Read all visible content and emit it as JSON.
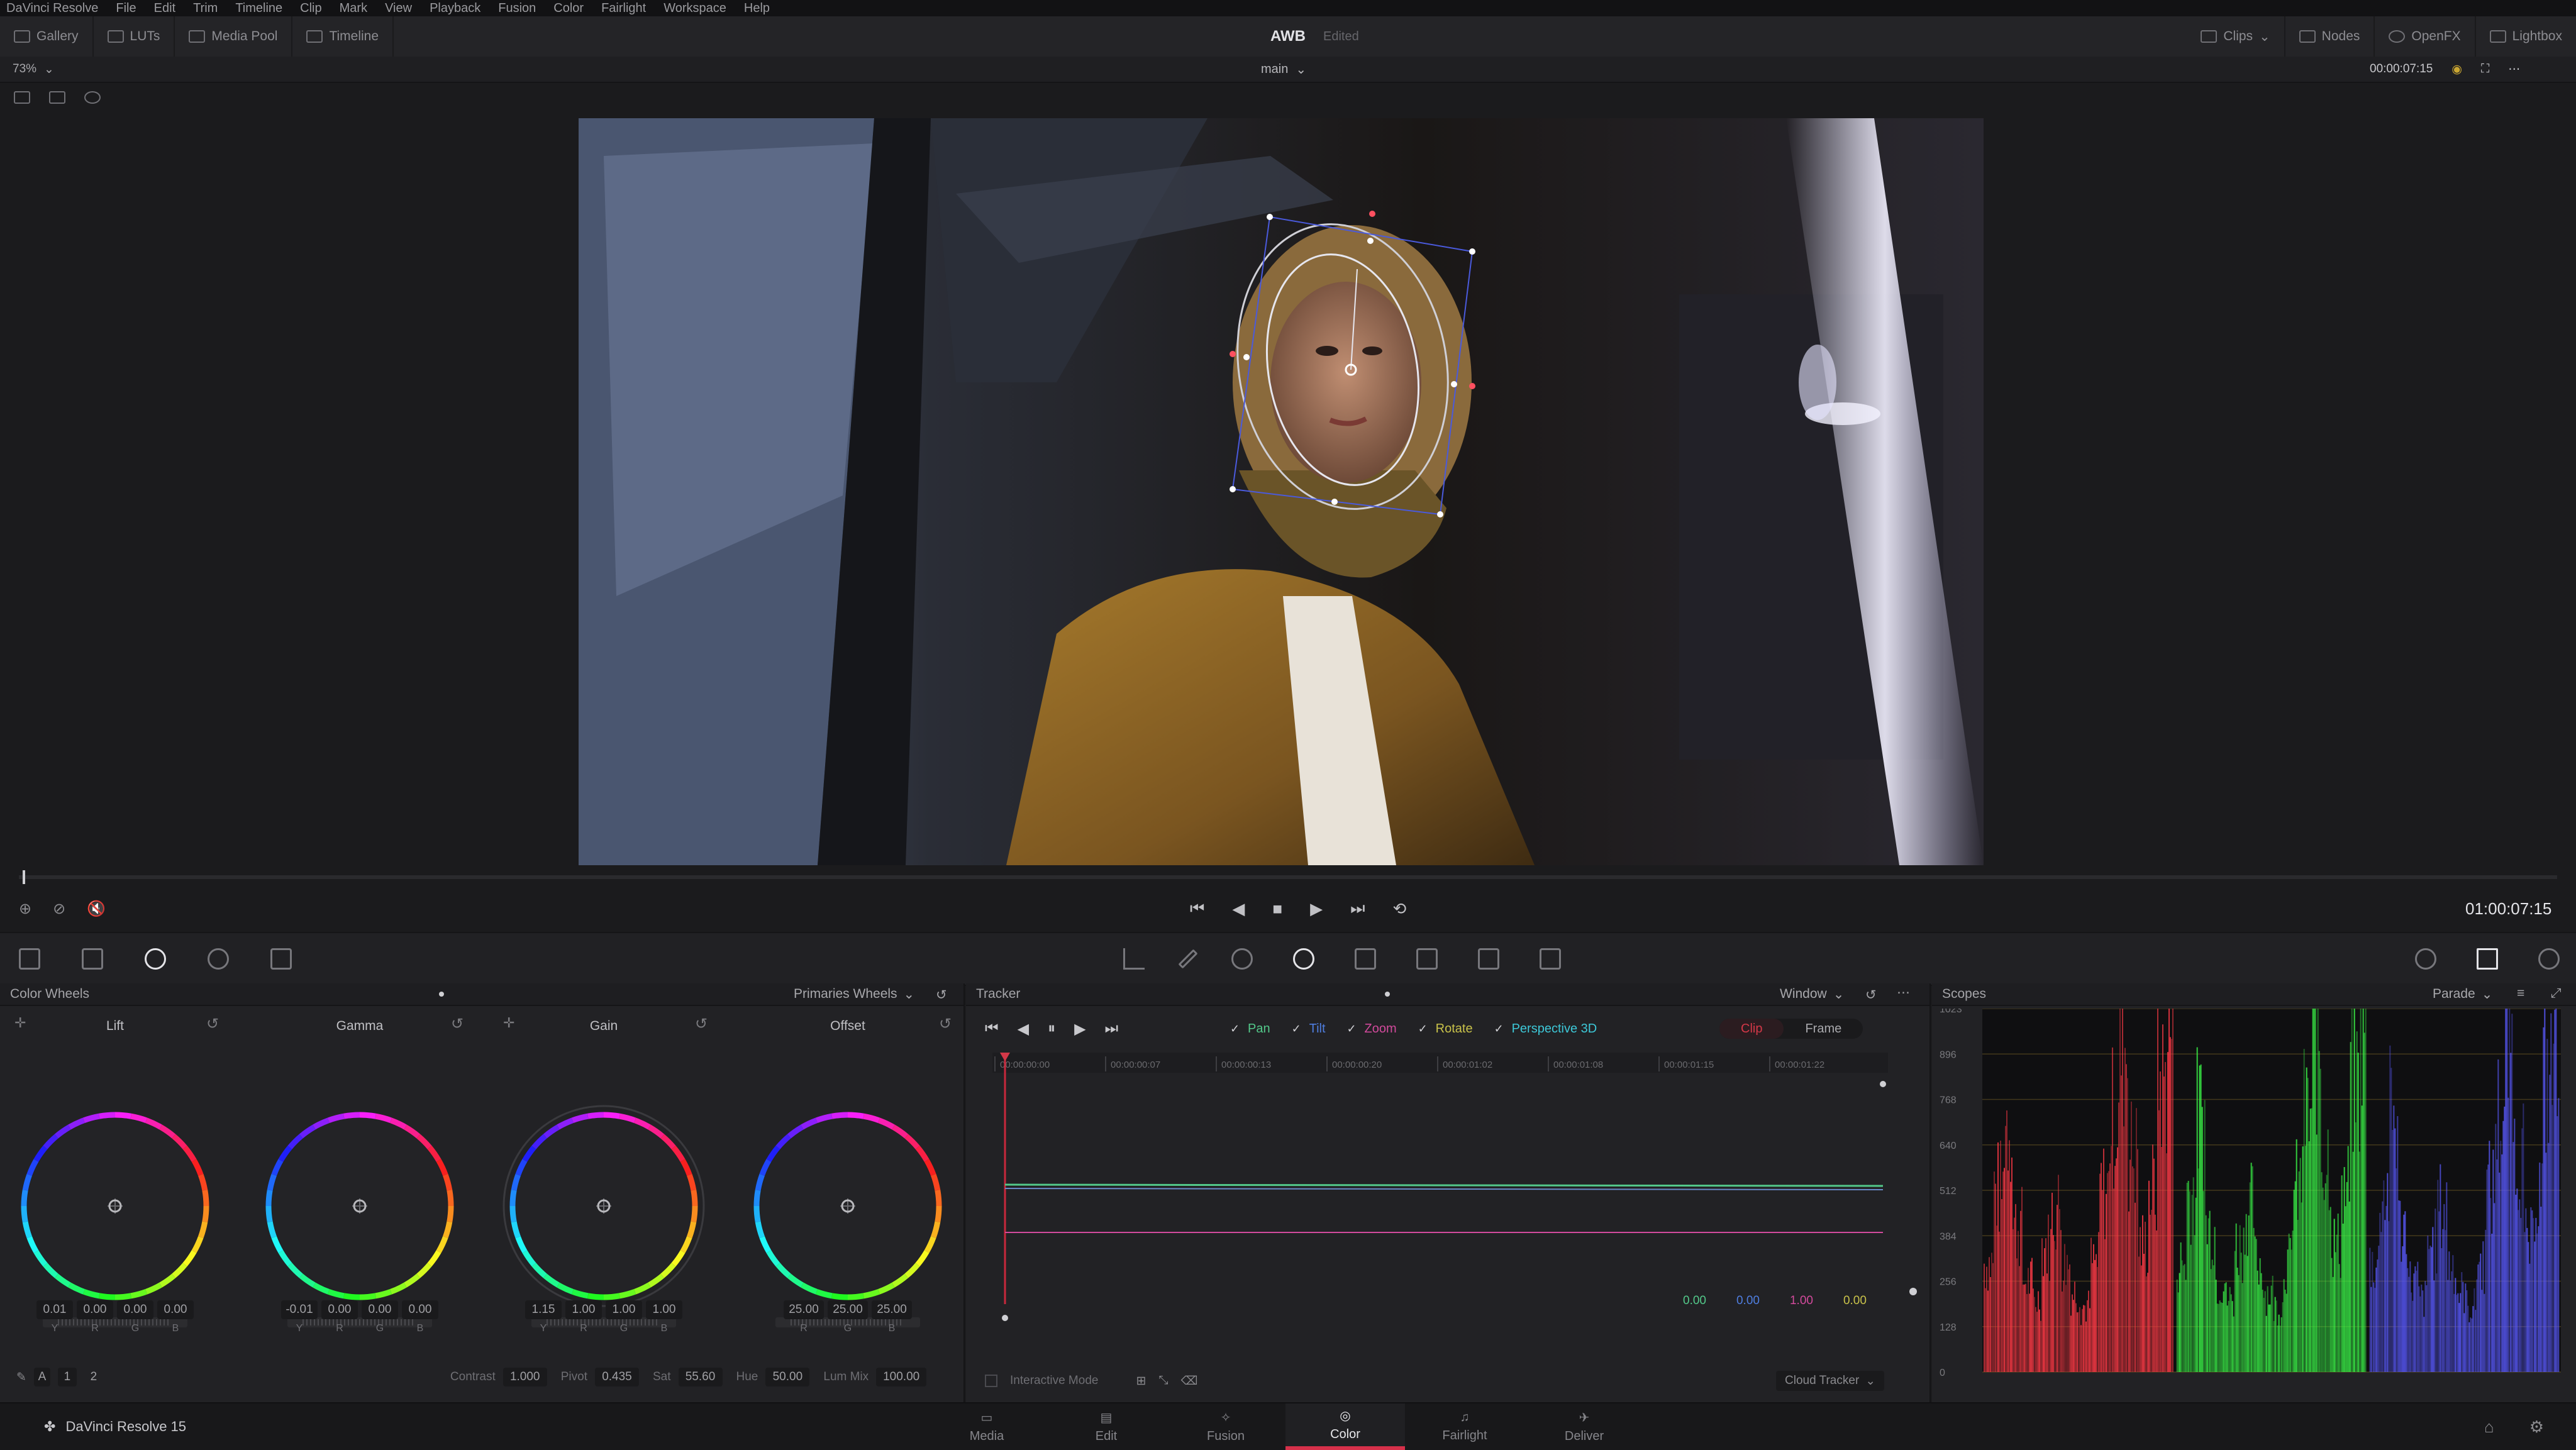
{
  "menu": [
    "DaVinci Resolve",
    "File",
    "Edit",
    "Trim",
    "Timeline",
    "Clip",
    "Mark",
    "View",
    "Playback",
    "Fusion",
    "Color",
    "Fairlight",
    "Workspace",
    "Help"
  ],
  "toolbar": {
    "left": [
      "Gallery",
      "LUTs",
      "Media Pool",
      "Timeline"
    ],
    "project_title": "AWB",
    "project_status": "Edited",
    "right": [
      "Clips",
      "Nodes",
      "OpenFX",
      "Lightbox"
    ]
  },
  "viewer": {
    "zoom": "73%",
    "timeline_name": "main",
    "source_timecode": "00:00:07:15",
    "record_timecode": "01:00:07:15"
  },
  "color_wheels": {
    "title": "Color Wheels",
    "mode": "Primaries Wheels",
    "wheels": [
      {
        "name": "Lift",
        "values": [
          "0.01",
          "0.00",
          "0.00",
          "0.00"
        ]
      },
      {
        "name": "Gamma",
        "values": [
          "-0.01",
          "0.00",
          "0.00",
          "0.00"
        ]
      },
      {
        "name": "Gain",
        "values": [
          "1.15",
          "1.00",
          "1.00",
          "1.00"
        ]
      },
      {
        "name": "Offset",
        "values": [
          "25.00",
          "25.00",
          "25.00"
        ]
      }
    ],
    "channel_labels": [
      "Y",
      "R",
      "G",
      "B"
    ],
    "offset_labels": [
      "R",
      "G",
      "B"
    ],
    "pages": [
      "1",
      "2"
    ],
    "adjust": {
      "contrast_label": "Contrast",
      "contrast": "1.000",
      "pivot_label": "Pivot",
      "pivot": "0.435",
      "sat_label": "Sat",
      "sat": "55.60",
      "hue_label": "Hue",
      "hue": "50.00",
      "lummix_label": "Lum Mix",
      "lummix": "100.00"
    }
  },
  "tracker": {
    "title": "Tracker",
    "mode": "Window",
    "options": [
      {
        "label": "Pan",
        "color": "#53c98a"
      },
      {
        "label": "Tilt",
        "color": "#4f7ee0"
      },
      {
        "label": "Zoom",
        "color": "#d24a9c"
      },
      {
        "label": "Rotate",
        "color": "#c9c24a"
      },
      {
        "label": "Perspective 3D",
        "color": "#3dc8d8"
      }
    ],
    "clip_label": "Clip",
    "frame_label": "Frame",
    "ruler": [
      "00:00:00:00",
      "00:00:00:07",
      "00:00:00:13",
      "00:00:00:20",
      "00:00:01:02",
      "00:00:01:08",
      "00:00:01:15",
      "00:00:01:22"
    ],
    "readout": [
      {
        "value": "0.00",
        "color": "#53c98a"
      },
      {
        "value": "0.00",
        "color": "#4f7ee0"
      },
      {
        "value": "1.00",
        "color": "#d24a9c"
      },
      {
        "value": "0.00",
        "color": "#c9c24a"
      }
    ],
    "interactive_mode": "Interactive Mode",
    "tracker_type": "Cloud Tracker"
  },
  "scopes": {
    "title": "Scopes",
    "mode": "Parade",
    "ticks": [
      "1023",
      "896",
      "768",
      "640",
      "512",
      "384",
      "256",
      "128",
      "0"
    ]
  },
  "app_name": "DaVinci Resolve 15",
  "pages": [
    {
      "label": "Media",
      "active": false
    },
    {
      "label": "Edit",
      "active": false
    },
    {
      "label": "Fusion",
      "active": false
    },
    {
      "label": "Color",
      "active": true
    },
    {
      "label": "Fairlight",
      "active": false
    },
    {
      "label": "Deliver",
      "active": false
    }
  ]
}
